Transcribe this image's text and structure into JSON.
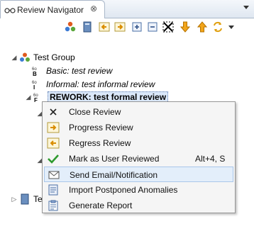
{
  "view": {
    "title": "Review Navigator",
    "close_glyph": "⊗",
    "menu_glyph": "▾"
  },
  "toolbar": {
    "buttons": [
      {
        "icon": "new-review-group-icon"
      },
      {
        "icon": "new-review-icon"
      },
      {
        "icon": "back-icon"
      },
      {
        "icon": "forward-icon"
      },
      {
        "icon": "expand-all-icon"
      },
      {
        "icon": "collapse-all-icon"
      },
      {
        "icon": "filter-icon"
      },
      {
        "icon": "move-down-icon"
      },
      {
        "icon": "move-up-icon"
      },
      {
        "icon": "refresh-icon"
      }
    ]
  },
  "tree": {
    "group": {
      "label": "Test Group",
      "twisty": "◢"
    },
    "reviews": [
      {
        "label": "Basic: test review",
        "style": "italic"
      },
      {
        "label": "Informal: test informal review",
        "style": "italic"
      },
      {
        "label": "REWORK: test formal review",
        "style": "bold"
      }
    ],
    "truncated_item": {
      "label": "Te",
      "twisty": "▷"
    }
  },
  "context_menu": {
    "items": [
      {
        "label": "Close Review",
        "icon": "close-x-icon",
        "accel": ""
      },
      {
        "label": "Progress Review",
        "icon": "progress-icon",
        "accel": ""
      },
      {
        "label": "Regress Review",
        "icon": "regress-icon",
        "accel": ""
      },
      {
        "label": "Mark as User Reviewed",
        "icon": "checkmark-icon",
        "accel": "Alt+4, S"
      },
      {
        "label": "Send Email/Notification",
        "icon": "email-icon",
        "accel": ""
      },
      {
        "label": "Import Postponed Anomalies",
        "icon": "import-icon",
        "accel": ""
      },
      {
        "label": "Generate Report",
        "icon": "report-icon",
        "accel": ""
      }
    ]
  },
  "colors": {
    "accent": "#3a6fb0",
    "check_green": "#2e9a2e",
    "arrow_orange": "#f2a51a"
  }
}
